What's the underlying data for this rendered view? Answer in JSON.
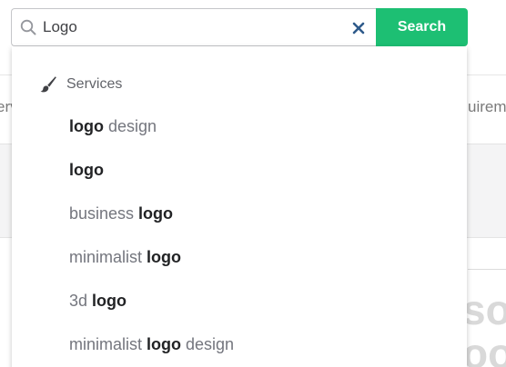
{
  "search": {
    "value": "Logo",
    "button_label": "Search"
  },
  "background": {
    "left_text": "erv",
    "right_text": "uireme",
    "big_text_1": "so",
    "big_text_2": "oo"
  },
  "dropdown": {
    "section": {
      "label": "Services",
      "icon": "brush-icon"
    },
    "suggestions": [
      {
        "prefix": "",
        "match": "logo",
        "suffix": " design"
      },
      {
        "prefix": "",
        "match": "logo",
        "suffix": ""
      },
      {
        "prefix": "business ",
        "match": "logo",
        "suffix": ""
      },
      {
        "prefix": "minimalist ",
        "match": "logo",
        "suffix": ""
      },
      {
        "prefix": "3d ",
        "match": "logo",
        "suffix": ""
      },
      {
        "prefix": "minimalist ",
        "match": "logo",
        "suffix": " design"
      }
    ]
  },
  "colors": {
    "accent": "#1dbf73",
    "text_primary": "#222325",
    "text_muted": "#74767e",
    "clear_icon": "#2e5a8a"
  }
}
